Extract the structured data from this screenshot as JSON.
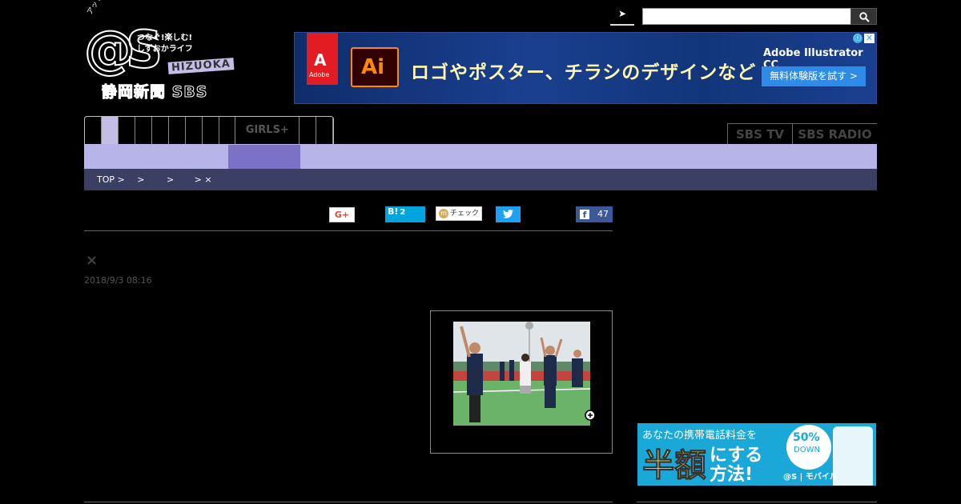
{
  "logo": {
    "vertical_text": "アットエス",
    "at_mark": "@S",
    "tagline_1": "つなぐ!楽しむ!",
    "tagline_2": "しずおかライフ",
    "hizuoka": "HIZUOKA",
    "paper_name": "静岡新聞 SBS"
  },
  "search": {
    "tab_icon": "arrow-icon",
    "placeholder": "",
    "button_icon": "search-icon"
  },
  "ad_top": {
    "adobe_label": "Adobe",
    "ai_label": "Ai",
    "headline": "ロゴやポスター、チラシのデザインなど",
    "product": "Adobe Illustrator CC",
    "cta": "無料体験版を試す >",
    "info_icon": "ⓘ",
    "close_icon": "✕"
  },
  "nav": {
    "items_before_active": 1,
    "girls_label": "GIRLS+",
    "sbs_tv": "SBS TV",
    "sbs_radio": "SBS RADIO"
  },
  "breadcrumb": {
    "items": [
      "TOP >",
      ">",
      ">",
      "> ×"
    ]
  },
  "share": {
    "gplus": "G+",
    "hatena": "B!",
    "hatena_count": "2",
    "mixi_label": "チェック",
    "mixi_icon": "m",
    "facebook_icon": "f",
    "facebook_count": "47"
  },
  "article": {
    "title": "×",
    "date": "2018/9/3 08:16"
  },
  "ad_side": {
    "line1": "あなたの携帯電話料金を",
    "big": "半額",
    "mid1": "にする",
    "mid2": "方法!",
    "badge_percent": "50%",
    "badge_down": "DOWN",
    "brand": "@S | モバイル"
  },
  "colors": {
    "nav_active": "#c4bde6",
    "sub_nav": "#b6b4e8",
    "sub_nav_active": "#7b72c6",
    "breadcrumb_bg": "#3b3f63"
  }
}
